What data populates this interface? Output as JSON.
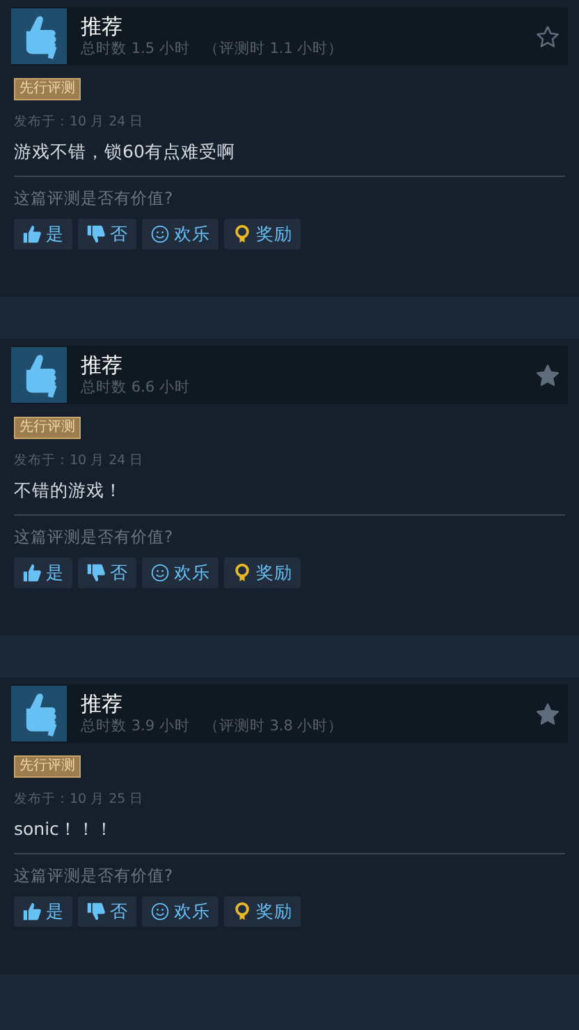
{
  "reviews": [
    {
      "title": "推荐",
      "playtime": "总时数 1.5 小时",
      "review_time": "（评测时 1.1 小时）",
      "starred": false,
      "tag": "先行评测",
      "posted": "发布于：10 月 24 日",
      "text": "游戏不错，锁60有点难受啊",
      "question": "这篇评测是否有价值?",
      "buttons": [
        {
          "kind": "yes",
          "label": "是"
        },
        {
          "kind": "no",
          "label": "否"
        },
        {
          "kind": "funny",
          "label": "欢乐"
        },
        {
          "kind": "award",
          "label": "奖励"
        }
      ]
    },
    {
      "title": "推荐",
      "playtime": "总时数 6.6 小时",
      "starred": true,
      "tag": "先行评测",
      "posted": "发布于：10 月 24 日",
      "text": "不错的游戏！",
      "question": "这篇评测是否有价值?",
      "buttons": [
        {
          "kind": "yes",
          "label": "是"
        },
        {
          "kind": "no",
          "label": "否"
        },
        {
          "kind": "funny",
          "label": "欢乐"
        },
        {
          "kind": "award",
          "label": "奖励"
        }
      ]
    },
    {
      "title": "推荐",
      "playtime": "总时数 3.9 小时",
      "review_time": "（评测时 3.8 小时）",
      "starred": true,
      "tag": "先行评测",
      "posted": "发布于：10 月 25 日",
      "text": "sonic！！！",
      "question": "这篇评测是否有价值?",
      "buttons": [
        {
          "kind": "yes",
          "label": "是"
        },
        {
          "kind": "no",
          "label": "否"
        },
        {
          "kind": "funny",
          "label": "欢乐"
        },
        {
          "kind": "award",
          "label": "奖励"
        }
      ]
    }
  ]
}
